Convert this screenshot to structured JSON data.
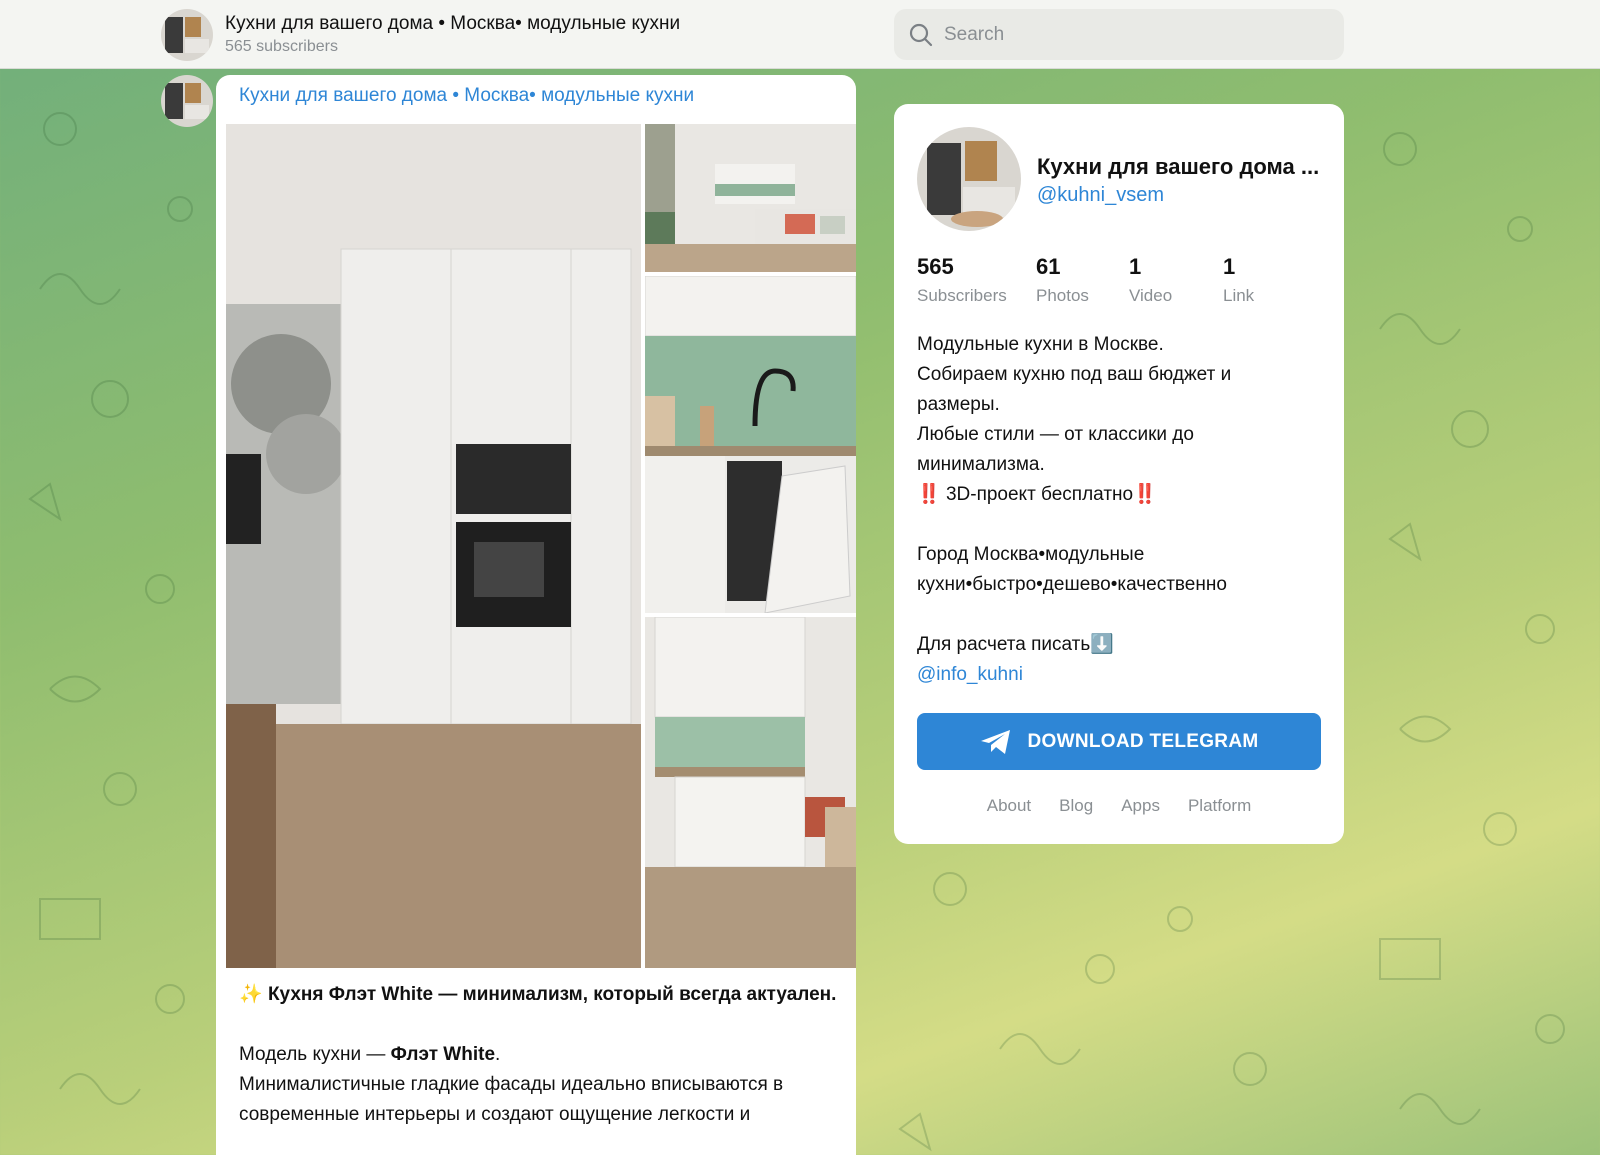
{
  "header": {
    "channel_title": "Кухни для вашего дома • Москва• модульные кухни",
    "subscribers": "565 subscribers",
    "search_placeholder": "Search"
  },
  "post": {
    "channel_link": "Кухни для вашего дома • Москва• модульные кухни",
    "text": {
      "p1_emoji": "✨",
      "p1": "Кухня Флэт White — минимализм, который всегда актуален.",
      "p2_prefix": "Модель кухни — ",
      "p2_bold": "Флэт White",
      "p2_suffix": ".",
      "p3": "Минималистичные гладкие фасады идеально вписываются в современные интерьеры и создают ощущение легкости и"
    }
  },
  "profile": {
    "name": "Кухни для вашего дома ...",
    "handle": "@kuhni_vsem",
    "stats": [
      {
        "num": "565",
        "label": "Subscribers"
      },
      {
        "num": "61",
        "label": "Photos"
      },
      {
        "num": "1",
        "label": "Video"
      },
      {
        "num": "1",
        "label": "Link"
      }
    ],
    "description": {
      "l1": "Модульные кухни в Москве.",
      "l2": "Собираем кухню под ваш бюджет и",
      "l3": "размеры.",
      "l4": "Любые стили — от классики до",
      "l5": "минимализма.",
      "l6_emoji_a": "‼️",
      "l6": " 3D-проект бесплатно",
      "l6_emoji_b": "‼️",
      "l8": "Город Москва•модульные",
      "l9": "кухни•быстро•дешево•качественно",
      "l11": "Для расчета писать",
      "l11_emoji": "⬇️",
      "l12": "@info_kuhni"
    },
    "download_button": "DOWNLOAD TELEGRAM",
    "footer_links": [
      "About",
      "Blog",
      "Apps",
      "Platform"
    ]
  },
  "colors": {
    "accent": "#2e86d6",
    "muted": "#8a8f93",
    "red_emoji": "#e0312b"
  }
}
